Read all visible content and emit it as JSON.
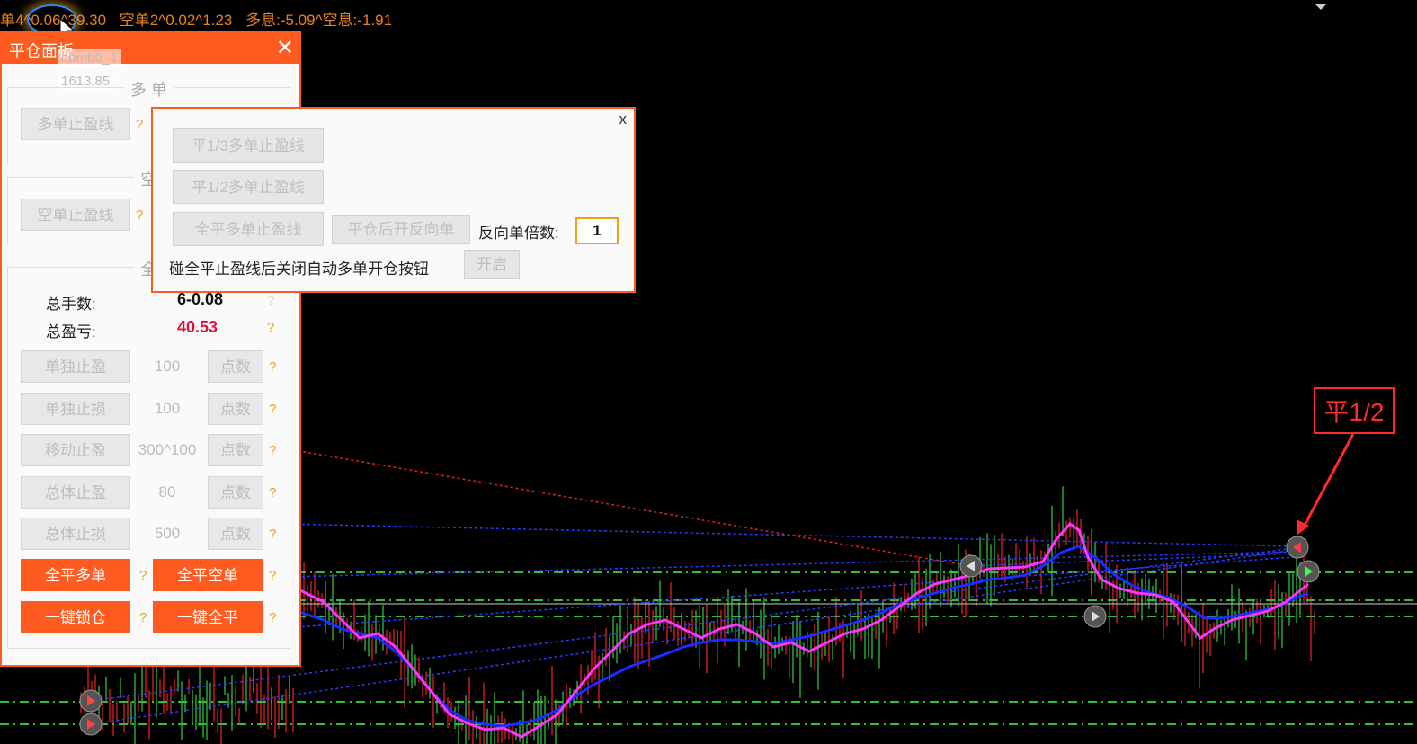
{
  "topbar": {
    "items": [
      "单4^0.06^39.30",
      "空单2^0.02^1.23",
      "多息:-5.09^空息:-1.91"
    ]
  },
  "panel": {
    "title": "平仓面板",
    "close": "✕",
    "ghost_name": "dbmb0_1",
    "ghost_price": "1613.85",
    "section_long": "多 单",
    "long_tp_btn": "多单止盈线",
    "section_short": "空",
    "short_tp_btn": "空单止盈线",
    "section_all": "全",
    "total_lots_label": "总手数:",
    "total_lots_value": "6-0.08",
    "total_pl_label": "总盈亏:",
    "total_pl_value": "40.53",
    "rows": [
      {
        "btn": "单独止盈",
        "value": "100",
        "unit": "点数"
      },
      {
        "btn": "单独止损",
        "value": "100",
        "unit": "点数"
      },
      {
        "btn": "移动止盈",
        "value": "300^100",
        "unit": "点数"
      },
      {
        "btn": "总体止盈",
        "value": "80",
        "unit": "点数"
      },
      {
        "btn": "总体止损",
        "value": "500",
        "unit": "点数"
      }
    ],
    "close_long": "全平多单",
    "close_short": "全平空单",
    "lock": "一键锁仓",
    "close_all": "一键全平",
    "help": "?"
  },
  "popup": {
    "close": "x",
    "btn_third": "平1/3多单止盈线",
    "btn_half": "平1/2多单止盈线",
    "btn_all": "全平多单止盈线",
    "btn_reverse": "平仓后开反向单",
    "reverse_multiplier_label": "反向单倍数:",
    "reverse_multiplier_value": "1",
    "auto_close_label": "碰全平止盈线后关闭自动多单开仓按钮",
    "open_btn": "开启"
  },
  "annotation": {
    "label": "平1/2"
  },
  "colors": {
    "accent": "#ff5a1f",
    "profit": "#e0103a",
    "ma_fast": "#ff33ff",
    "ma_slow": "#1a2cff",
    "level_line": "#2fbf3a"
  }
}
